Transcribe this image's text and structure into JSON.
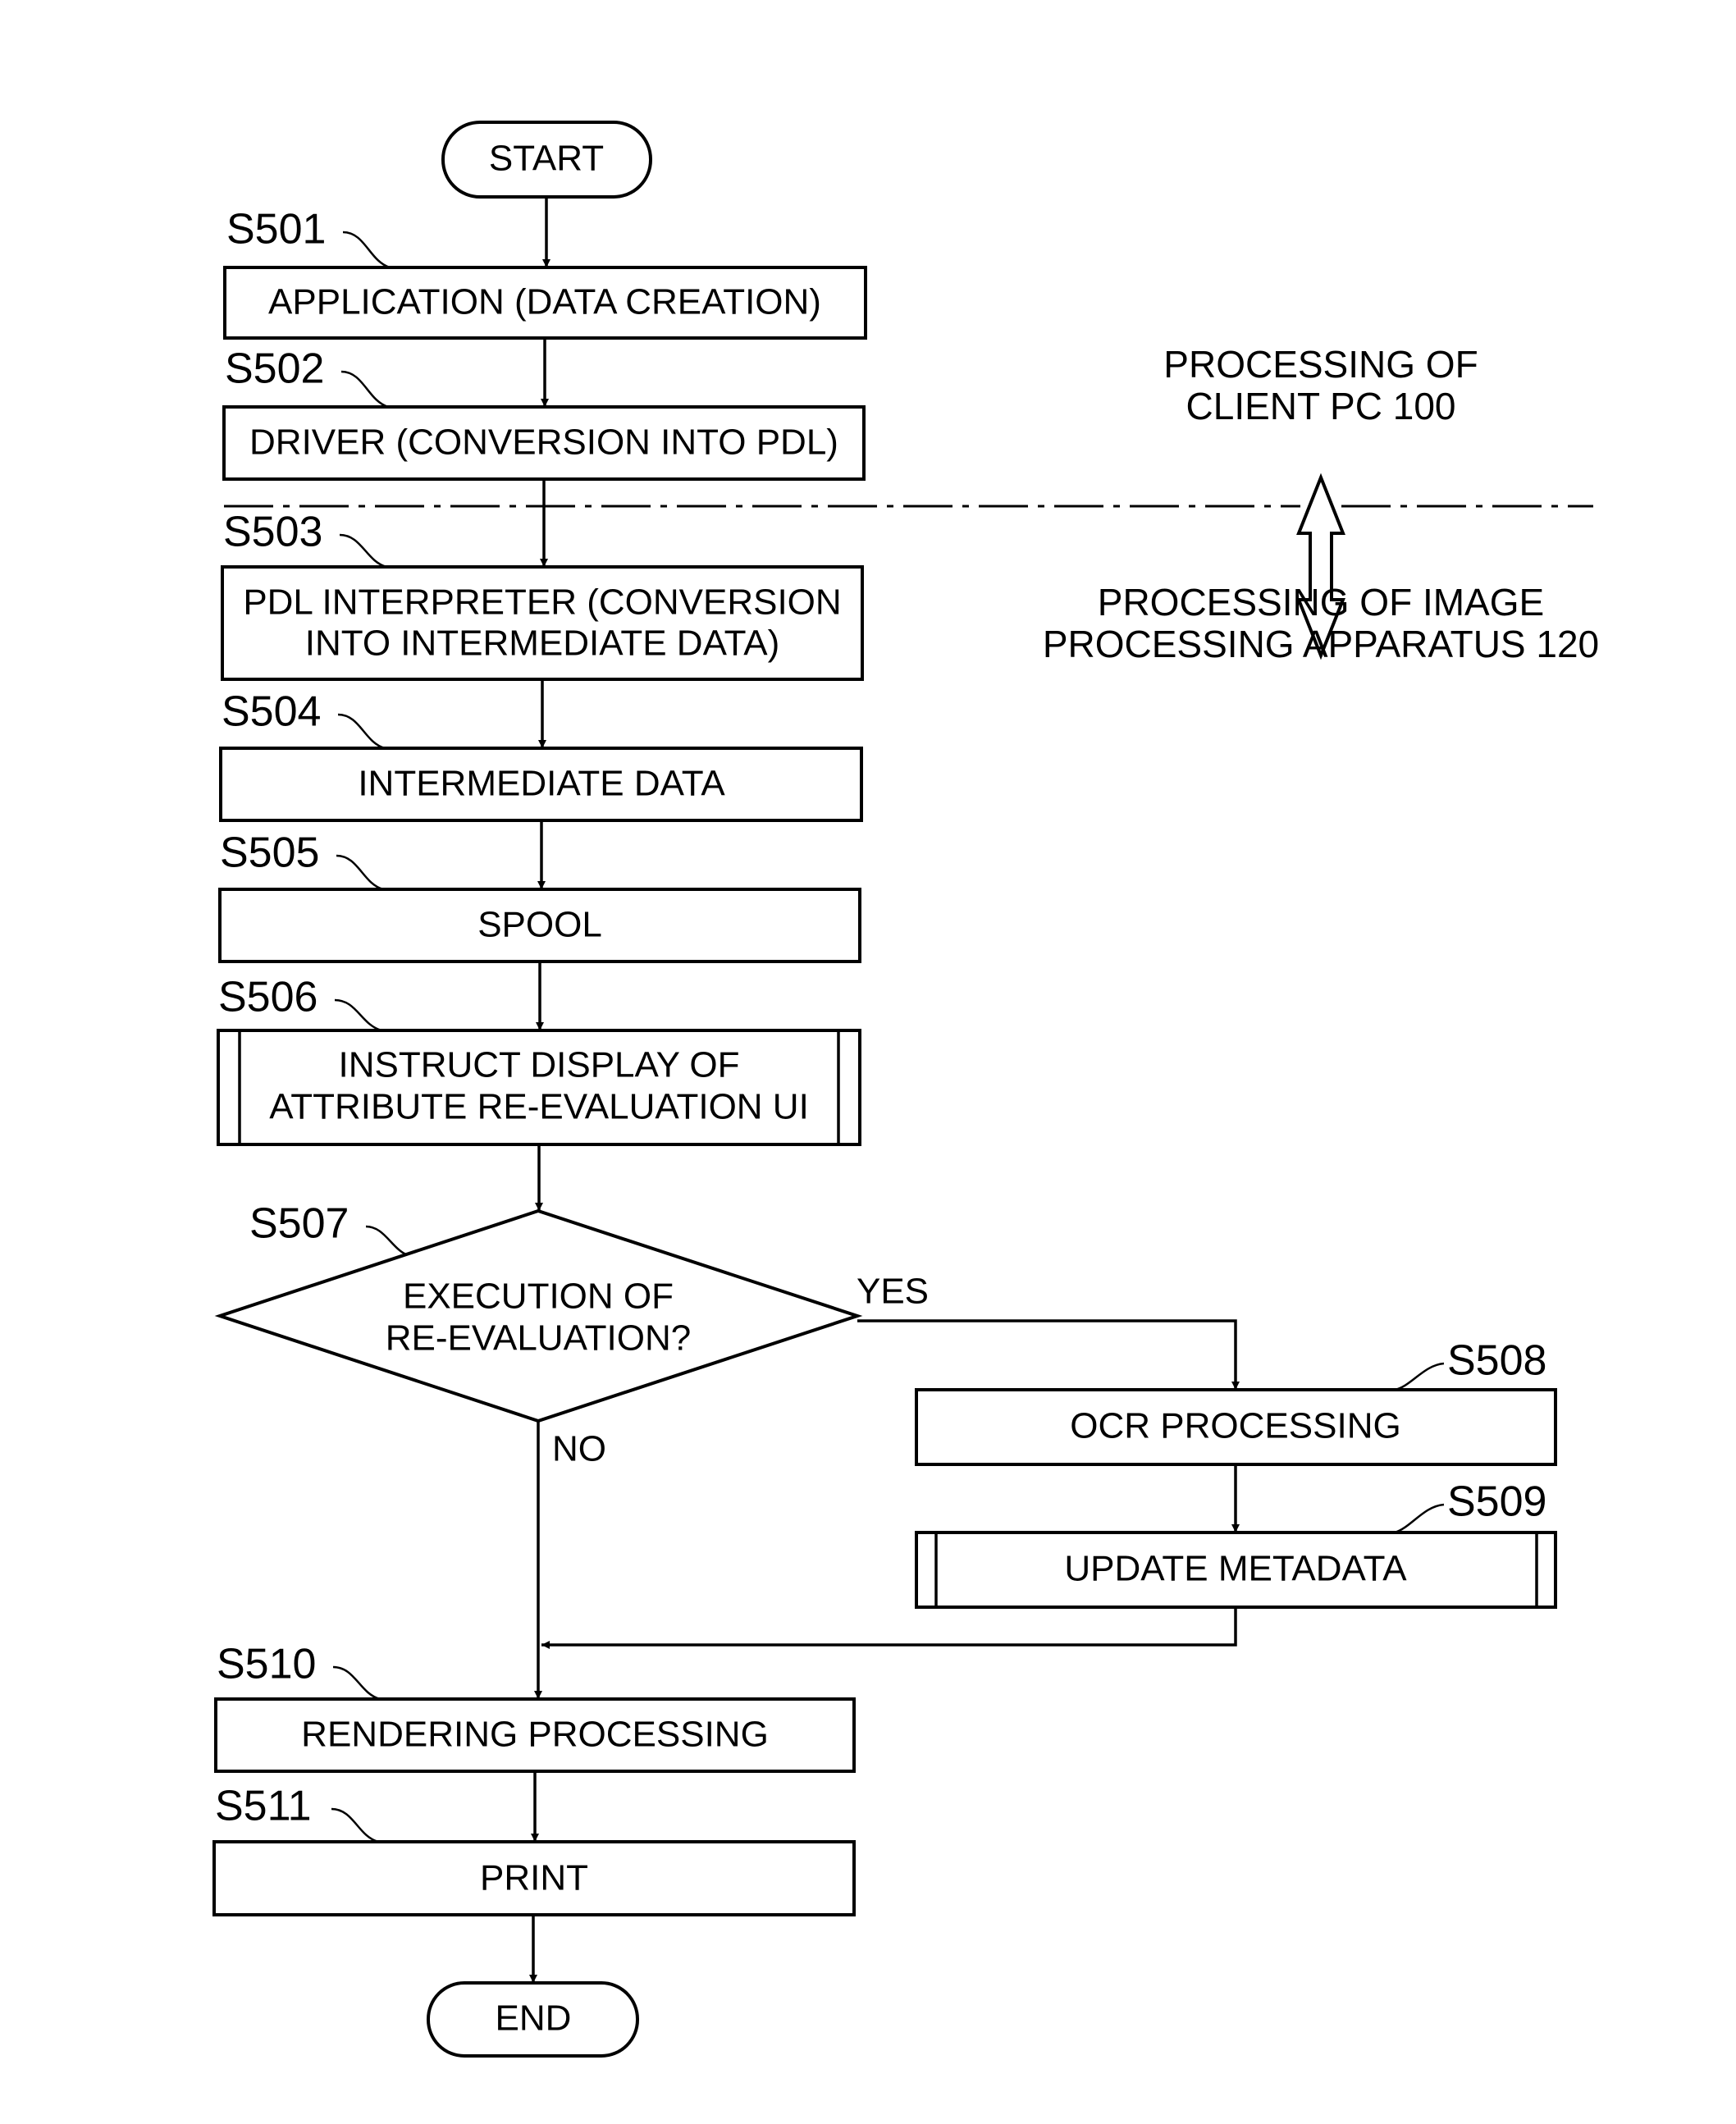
{
  "diagram": {
    "type": "flowchart",
    "colors": {
      "stroke": "#000000",
      "background": "#ffffff"
    },
    "terminals": {
      "start": "START",
      "end": "END"
    },
    "steps": [
      {
        "id": "S501",
        "label": "S501",
        "kind": "process",
        "lines": [
          "APPLICATION (DATA CREATION)"
        ]
      },
      {
        "id": "S502",
        "label": "S502",
        "kind": "process",
        "lines": [
          "DRIVER (CONVERSION INTO PDL)"
        ]
      },
      {
        "id": "S503",
        "label": "S503",
        "kind": "process",
        "lines": [
          "PDL INTERPRETER (CONVERSION",
          "INTO INTERMEDIATE DATA)"
        ]
      },
      {
        "id": "S504",
        "label": "S504",
        "kind": "process",
        "lines": [
          "INTERMEDIATE DATA"
        ]
      },
      {
        "id": "S505",
        "label": "S505",
        "kind": "process",
        "lines": [
          "SPOOL"
        ]
      },
      {
        "id": "S506",
        "label": "S506",
        "kind": "predefined-process",
        "lines": [
          "INSTRUCT DISPLAY OF",
          "ATTRIBUTE RE-EVALUATION UI"
        ]
      },
      {
        "id": "S507",
        "label": "S507",
        "kind": "decision",
        "lines": [
          "EXECUTION OF",
          "RE-EVALUATION?"
        ]
      },
      {
        "id": "S508",
        "label": "S508",
        "kind": "process",
        "lines": [
          "OCR PROCESSING"
        ]
      },
      {
        "id": "S509",
        "label": "S509",
        "kind": "predefined-process",
        "lines": [
          "UPDATE METADATA"
        ]
      },
      {
        "id": "S510",
        "label": "S510",
        "kind": "process",
        "lines": [
          "RENDERING PROCESSING"
        ]
      },
      {
        "id": "S511",
        "label": "S511",
        "kind": "process",
        "lines": [
          "PRINT"
        ]
      }
    ],
    "branches": {
      "yes": "YES",
      "no": "NO"
    },
    "edges": [
      [
        "START",
        "S501"
      ],
      [
        "S501",
        "S502"
      ],
      [
        "S502",
        "S503"
      ],
      [
        "S503",
        "S504"
      ],
      [
        "S504",
        "S505"
      ],
      [
        "S505",
        "S506"
      ],
      [
        "S506",
        "S507"
      ],
      [
        "S507",
        "S508",
        "YES"
      ],
      [
        "S508",
        "S509"
      ],
      [
        "S509",
        "S510"
      ],
      [
        "S507",
        "S510",
        "NO"
      ],
      [
        "S510",
        "S511"
      ],
      [
        "S511",
        "END"
      ]
    ],
    "boundary": {
      "upper_label": [
        "PROCESSING OF",
        "CLIENT PC 100"
      ],
      "lower_label": [
        "PROCESSING OF IMAGE",
        "PROCESSING APPARATUS 120"
      ]
    }
  }
}
